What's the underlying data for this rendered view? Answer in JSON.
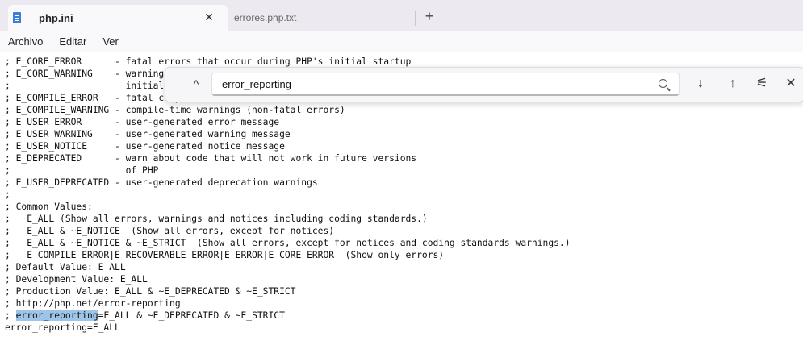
{
  "tabs": [
    {
      "title": "php.ini",
      "close": "✕",
      "active": true,
      "icon": "notepad-icon"
    },
    {
      "title": "errores.php.txt",
      "active": false
    }
  ],
  "new_tab": "+",
  "menu": [
    "Archivo",
    "Editar",
    "Ver"
  ],
  "find": {
    "collapse": "^",
    "query": "error_reporting",
    "next": "↓",
    "prev": "↑",
    "options": "⚟",
    "close": "✕"
  },
  "editor": {
    "lines": [
      "; E_CORE_ERROR      - fatal errors that occur during PHP's initial startup",
      "; E_CORE_WARNING    - warnings (non-fatal errors) that occur during PHP's",
      ";                     initial startup",
      "; E_COMPILE_ERROR   - fatal compile-time errors",
      "; E_COMPILE_WARNING - compile-time warnings (non-fatal errors)",
      "; E_USER_ERROR      - user-generated error message",
      "; E_USER_WARNING    - user-generated warning message",
      "; E_USER_NOTICE     - user-generated notice message",
      "; E_DEPRECATED      - warn about code that will not work in future versions",
      ";                     of PHP",
      "; E_USER_DEPRECATED - user-generated deprecation warnings",
      ";",
      "; Common Values:",
      ";   E_ALL (Show all errors, warnings and notices including coding standards.)",
      ";   E_ALL & ~E_NOTICE  (Show all errors, except for notices)",
      ";   E_ALL & ~E_NOTICE & ~E_STRICT  (Show all errors, except for notices and coding standards warnings.)",
      ";   E_COMPILE_ERROR|E_RECOVERABLE_ERROR|E_ERROR|E_CORE_ERROR  (Show only errors)",
      "; Default Value: E_ALL",
      "; Development Value: E_ALL",
      "; Production Value: E_ALL & ~E_DEPRECATED & ~E_STRICT",
      "; http://php.net/error-reporting",
      "; ",
      "error_reporting=E_ALL"
    ],
    "match_prefix": "; ",
    "match_text": "error_reporting",
    "match_suffix": "=E_ALL & ~E_DEPRECATED & ~E_STRICT"
  }
}
